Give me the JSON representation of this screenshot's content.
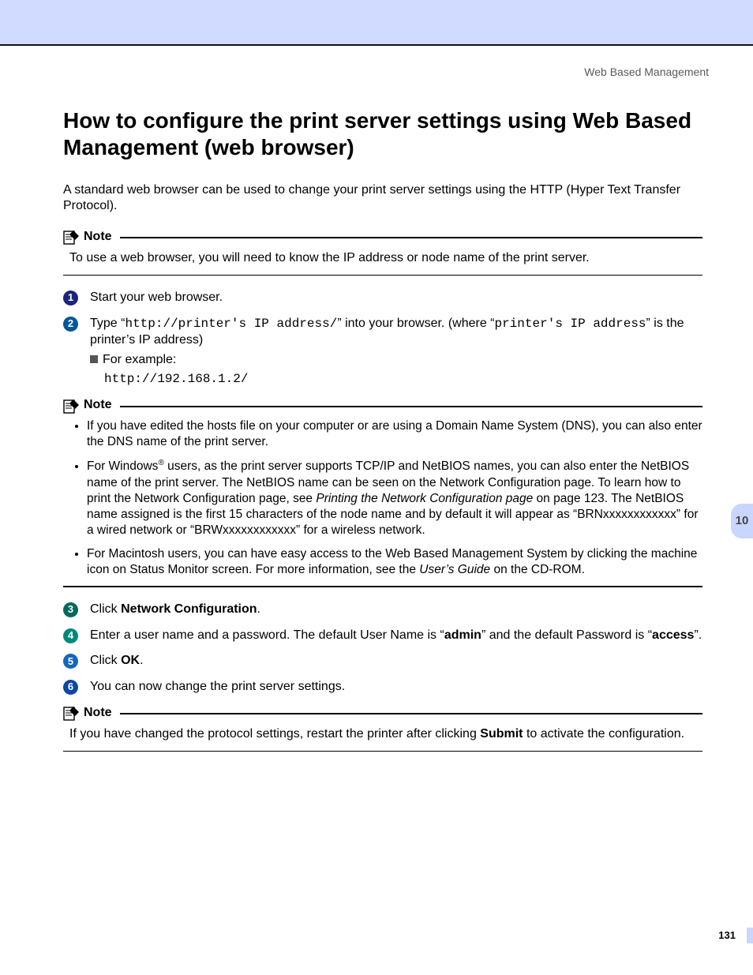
{
  "running_header": "Web Based Management",
  "h1": "How to configure the print server settings using Web Based Management (web browser)",
  "intro": "A standard web browser can be used to change your print server settings using the HTTP (Hyper Text Transfer Protocol).",
  "note_label": "Note",
  "note1_body": "To use a web browser, you will need to know the IP address or node name of the print server.",
  "steps": {
    "s1": "Start your web browser.",
    "s2_pre": "Type “",
    "s2_code1": "http://printer's IP address/",
    "s2_mid": "” into your browser. (where “",
    "s2_code2": "printer's IP address",
    "s2_post": "” is the printer’s IP address)",
    "s2_example_label": "For example:",
    "s2_example_code": "http://192.168.1.2/",
    "s3_pre": "Click ",
    "s3_bold": "Network Configuration",
    "s3_post": ".",
    "s4_a": "Enter a user name and a password. The default User Name is “",
    "s4_admin": "admin",
    "s4_b": "” and the default Password is “",
    "s4_access": "access",
    "s4_c": "”.",
    "s5_pre": "Click ",
    "s5_bold": "OK",
    "s5_post": ".",
    "s6": "You can now change the print server settings."
  },
  "note2": {
    "b1": "If you have edited the hosts file on your computer or are using a Domain Name System (DNS), you can also enter the DNS name of the print server.",
    "b2_a": "For Windows",
    "b2_b": " users, as the print server supports TCP/IP and NetBIOS names, you can also enter the NetBIOS name of the print server. The NetBIOS name can be seen on the Network Configuration page. To learn how to print the Network Configuration page, see ",
    "b2_link": "Printing the Network Configuration page",
    "b2_c": " on page 123. The NetBIOS name assigned is the first 15 characters of the node name and by default it will appear as “BRNxxxxxxxxxxxx” for a wired network or “BRWxxxxxxxxxxxx” for a wireless network.",
    "b3_a": "For Macintosh users, you can have easy access to the Web Based Management System by clicking the machine icon on Status Monitor screen. For more information, see the ",
    "b3_link": "User’s Guide",
    "b3_b": " on the CD-ROM."
  },
  "note3_a": "If you have changed the protocol settings, restart the printer after clicking ",
  "note3_bold": "Submit",
  "note3_b": " to activate the configuration.",
  "side_tab": "10",
  "page_number": "131",
  "step_colors": {
    "c1": "#1a237e",
    "c2": "#01579b",
    "c3": "#00695c",
    "c4": "#00897b",
    "c5": "#1565c0",
    "c6": "#0d47a1"
  }
}
